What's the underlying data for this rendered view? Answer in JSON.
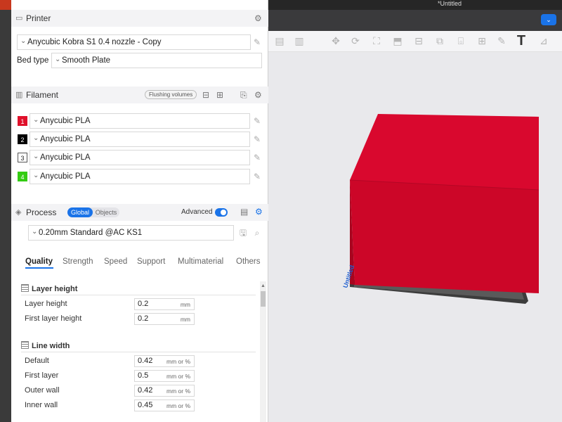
{
  "window": {
    "title": "*Untitled"
  },
  "printer": {
    "header": "Printer",
    "preset": "Anycubic Kobra S1 0.4 nozzle - Copy",
    "bed_type_label": "Bed type",
    "bed_type": "Smooth Plate"
  },
  "filament": {
    "header": "Filament",
    "flushing_label": "Flushing volumes",
    "items": [
      {
        "num": "1",
        "name": "Anycubic PLA",
        "color": "#e0112b",
        "text_color": "#ffffff"
      },
      {
        "num": "2",
        "name": "Anycubic PLA",
        "color": "#000000",
        "text_color": "#ffffff"
      },
      {
        "num": "3",
        "name": "Anycubic PLA",
        "color": "#ffffff",
        "text_color": "#222222"
      },
      {
        "num": "4",
        "name": "Anycubic PLA",
        "color": "#33cc11",
        "text_color": "#ffffff"
      }
    ]
  },
  "process": {
    "header": "Process",
    "mode_global": "Global",
    "mode_objects": "Objects",
    "advanced_label": "Advanced",
    "advanced_on": true,
    "preset": "0.20mm Standard @AC KS1"
  },
  "tabs": [
    "Quality",
    "Strength",
    "Speed",
    "Support",
    "Multimaterial",
    "Others"
  ],
  "groups": {
    "layer_height": {
      "title": "Layer height",
      "params": [
        {
          "label": "Layer height",
          "value": "0.2",
          "unit": "mm"
        },
        {
          "label": "First layer height",
          "value": "0.2",
          "unit": "mm"
        }
      ]
    },
    "line_width": {
      "title": "Line width",
      "params": [
        {
          "label": "Default",
          "value": "0.42",
          "unit": "mm or %"
        },
        {
          "label": "First layer",
          "value": "0.5",
          "unit": "mm or %"
        },
        {
          "label": "Outer wall",
          "value": "0.42",
          "unit": "mm or %"
        },
        {
          "label": "Inner wall",
          "value": "0.45",
          "unit": "mm or %"
        }
      ]
    }
  },
  "plate": {
    "label": "Untitled",
    "object_color": "#d9082e"
  },
  "colors": {
    "accent": "#1a73e8"
  }
}
